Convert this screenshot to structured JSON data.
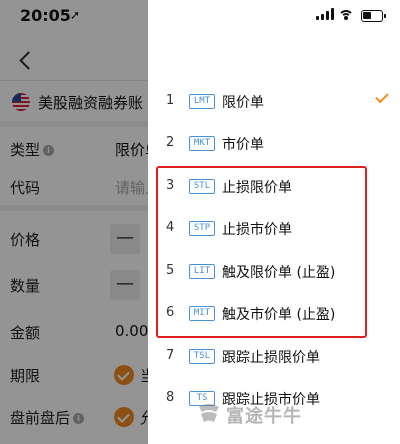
{
  "status": {
    "time": "20:05",
    "location_glyph": "➚"
  },
  "account": {
    "name": "美股融资融券账"
  },
  "form": {
    "rows": [
      {
        "label": "类型",
        "info": true,
        "value": "限价单",
        "kind": "value"
      },
      {
        "label": "代码",
        "info": false,
        "value": "请输入",
        "kind": "placeholder"
      },
      {
        "label": "价格",
        "info": false,
        "value": "—",
        "kind": "stepper"
      },
      {
        "label": "数量",
        "info": false,
        "value": "—",
        "kind": "stepper"
      },
      {
        "label": "金额",
        "info": false,
        "value": "0.00",
        "kind": "value"
      },
      {
        "label": "期限",
        "info": false,
        "value": "当",
        "kind": "check"
      },
      {
        "label": "盘前盘后",
        "info": true,
        "value": "允",
        "kind": "check"
      }
    ]
  },
  "order_types": [
    {
      "num": "1",
      "code": "LMT",
      "name": "限价单",
      "selected": true
    },
    {
      "num": "2",
      "code": "MKT",
      "name": "市价单",
      "selected": false
    },
    {
      "num": "3",
      "code": "STL",
      "name": "止损限价单",
      "selected": false
    },
    {
      "num": "4",
      "code": "STP",
      "name": "止损市价单",
      "selected": false
    },
    {
      "num": "5",
      "code": "LIT",
      "name": "触及限价单 (止盈)",
      "selected": false
    },
    {
      "num": "6",
      "code": "MIT",
      "name": "触及市价单 (止盈)",
      "selected": false
    },
    {
      "num": "7",
      "code": "TSL",
      "name": "跟踪止损限价单",
      "selected": false
    },
    {
      "num": "8",
      "code": "TS",
      "name": "跟踪止损市价单",
      "selected": false
    }
  ],
  "watermark": {
    "text": "富途牛牛"
  },
  "colors": {
    "accent": "#f08c24",
    "code_blue": "#4a90d9",
    "highlight": "#e02020"
  }
}
